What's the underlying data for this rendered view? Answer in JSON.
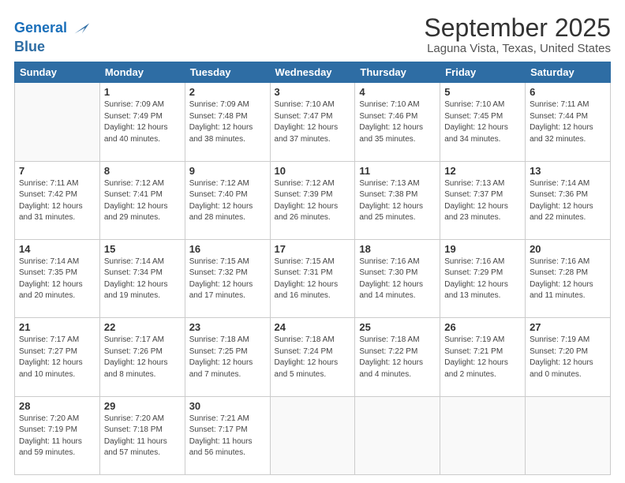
{
  "logo": {
    "line1": "General",
    "line2": "Blue"
  },
  "title": "September 2025",
  "subtitle": "Laguna Vista, Texas, United States",
  "days_of_week": [
    "Sunday",
    "Monday",
    "Tuesday",
    "Wednesday",
    "Thursday",
    "Friday",
    "Saturday"
  ],
  "weeks": [
    [
      {
        "day": "",
        "info": ""
      },
      {
        "day": "1",
        "info": "Sunrise: 7:09 AM\nSunset: 7:49 PM\nDaylight: 12 hours\nand 40 minutes."
      },
      {
        "day": "2",
        "info": "Sunrise: 7:09 AM\nSunset: 7:48 PM\nDaylight: 12 hours\nand 38 minutes."
      },
      {
        "day": "3",
        "info": "Sunrise: 7:10 AM\nSunset: 7:47 PM\nDaylight: 12 hours\nand 37 minutes."
      },
      {
        "day": "4",
        "info": "Sunrise: 7:10 AM\nSunset: 7:46 PM\nDaylight: 12 hours\nand 35 minutes."
      },
      {
        "day": "5",
        "info": "Sunrise: 7:10 AM\nSunset: 7:45 PM\nDaylight: 12 hours\nand 34 minutes."
      },
      {
        "day": "6",
        "info": "Sunrise: 7:11 AM\nSunset: 7:44 PM\nDaylight: 12 hours\nand 32 minutes."
      }
    ],
    [
      {
        "day": "7",
        "info": "Sunrise: 7:11 AM\nSunset: 7:42 PM\nDaylight: 12 hours\nand 31 minutes."
      },
      {
        "day": "8",
        "info": "Sunrise: 7:12 AM\nSunset: 7:41 PM\nDaylight: 12 hours\nand 29 minutes."
      },
      {
        "day": "9",
        "info": "Sunrise: 7:12 AM\nSunset: 7:40 PM\nDaylight: 12 hours\nand 28 minutes."
      },
      {
        "day": "10",
        "info": "Sunrise: 7:12 AM\nSunset: 7:39 PM\nDaylight: 12 hours\nand 26 minutes."
      },
      {
        "day": "11",
        "info": "Sunrise: 7:13 AM\nSunset: 7:38 PM\nDaylight: 12 hours\nand 25 minutes."
      },
      {
        "day": "12",
        "info": "Sunrise: 7:13 AM\nSunset: 7:37 PM\nDaylight: 12 hours\nand 23 minutes."
      },
      {
        "day": "13",
        "info": "Sunrise: 7:14 AM\nSunset: 7:36 PM\nDaylight: 12 hours\nand 22 minutes."
      }
    ],
    [
      {
        "day": "14",
        "info": "Sunrise: 7:14 AM\nSunset: 7:35 PM\nDaylight: 12 hours\nand 20 minutes."
      },
      {
        "day": "15",
        "info": "Sunrise: 7:14 AM\nSunset: 7:34 PM\nDaylight: 12 hours\nand 19 minutes."
      },
      {
        "day": "16",
        "info": "Sunrise: 7:15 AM\nSunset: 7:32 PM\nDaylight: 12 hours\nand 17 minutes."
      },
      {
        "day": "17",
        "info": "Sunrise: 7:15 AM\nSunset: 7:31 PM\nDaylight: 12 hours\nand 16 minutes."
      },
      {
        "day": "18",
        "info": "Sunrise: 7:16 AM\nSunset: 7:30 PM\nDaylight: 12 hours\nand 14 minutes."
      },
      {
        "day": "19",
        "info": "Sunrise: 7:16 AM\nSunset: 7:29 PM\nDaylight: 12 hours\nand 13 minutes."
      },
      {
        "day": "20",
        "info": "Sunrise: 7:16 AM\nSunset: 7:28 PM\nDaylight: 12 hours\nand 11 minutes."
      }
    ],
    [
      {
        "day": "21",
        "info": "Sunrise: 7:17 AM\nSunset: 7:27 PM\nDaylight: 12 hours\nand 10 minutes."
      },
      {
        "day": "22",
        "info": "Sunrise: 7:17 AM\nSunset: 7:26 PM\nDaylight: 12 hours\nand 8 minutes."
      },
      {
        "day": "23",
        "info": "Sunrise: 7:18 AM\nSunset: 7:25 PM\nDaylight: 12 hours\nand 7 minutes."
      },
      {
        "day": "24",
        "info": "Sunrise: 7:18 AM\nSunset: 7:24 PM\nDaylight: 12 hours\nand 5 minutes."
      },
      {
        "day": "25",
        "info": "Sunrise: 7:18 AM\nSunset: 7:22 PM\nDaylight: 12 hours\nand 4 minutes."
      },
      {
        "day": "26",
        "info": "Sunrise: 7:19 AM\nSunset: 7:21 PM\nDaylight: 12 hours\nand 2 minutes."
      },
      {
        "day": "27",
        "info": "Sunrise: 7:19 AM\nSunset: 7:20 PM\nDaylight: 12 hours\nand 0 minutes."
      }
    ],
    [
      {
        "day": "28",
        "info": "Sunrise: 7:20 AM\nSunset: 7:19 PM\nDaylight: 11 hours\nand 59 minutes."
      },
      {
        "day": "29",
        "info": "Sunrise: 7:20 AM\nSunset: 7:18 PM\nDaylight: 11 hours\nand 57 minutes."
      },
      {
        "day": "30",
        "info": "Sunrise: 7:21 AM\nSunset: 7:17 PM\nDaylight: 11 hours\nand 56 minutes."
      },
      {
        "day": "",
        "info": ""
      },
      {
        "day": "",
        "info": ""
      },
      {
        "day": "",
        "info": ""
      },
      {
        "day": "",
        "info": ""
      }
    ]
  ]
}
